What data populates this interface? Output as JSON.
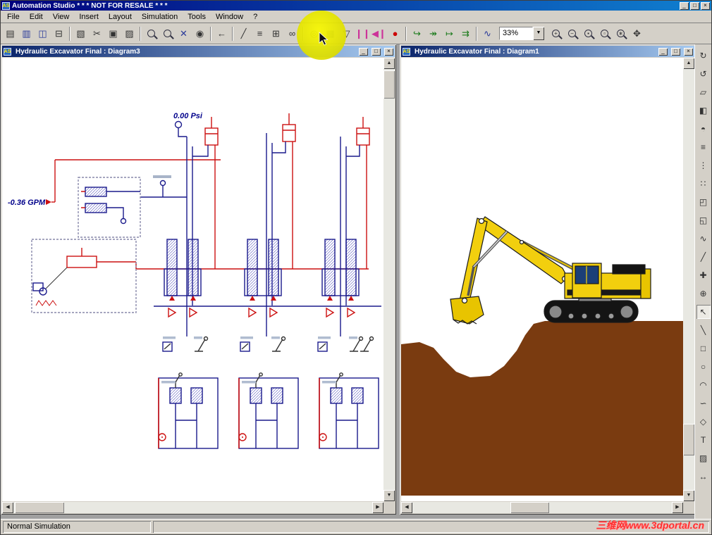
{
  "chrome": {
    "minimize": "_",
    "maximize": "□",
    "close": "×",
    "dropdown": "▼"
  },
  "scroll": {
    "up": "▲",
    "down": "▼",
    "left": "◀",
    "right": "▶"
  },
  "titlebar": {
    "app_icon": "AS",
    "title": "Automation Studio  * * *  NOT FOR RESALE  * * *"
  },
  "menubar": {
    "items": [
      "File",
      "Edit",
      "View",
      "Insert",
      "Layout",
      "Simulation",
      "Tools",
      "Window",
      "?"
    ]
  },
  "toolbar": {
    "zoom_value": "33%",
    "buttons": [
      {
        "name": "new-button",
        "glyph": "▤"
      },
      {
        "name": "open-button",
        "glyph": "▥"
      },
      {
        "name": "save-button",
        "glyph": "◫"
      },
      {
        "name": "print-button",
        "glyph": "⊟"
      },
      {
        "name": "preview-button",
        "glyph": "▧"
      },
      {
        "name": "cut-button",
        "glyph": "✂"
      },
      {
        "name": "copy-button",
        "glyph": "▣"
      },
      {
        "name": "paste-button",
        "glyph": "▨"
      },
      {
        "name": "find-button",
        "glyph": ""
      },
      {
        "name": "zoom-selection-button",
        "glyph": ""
      },
      {
        "name": "component-search-button",
        "glyph": "✕"
      },
      {
        "name": "snapshot-button",
        "glyph": "◉"
      },
      {
        "name": "undo-button",
        "glyph": "←"
      },
      {
        "name": "line-tool-button",
        "glyph": "╱"
      },
      {
        "name": "polyline-tool-button",
        "glyph": "≡"
      },
      {
        "name": "grid-button",
        "glyph": "⊞"
      },
      {
        "name": "link-button",
        "glyph": "∞"
      },
      {
        "name": "probe-button",
        "glyph": "◎"
      },
      {
        "name": "measure-button",
        "glyph": "▦"
      },
      {
        "name": "trigger-button",
        "glyph": "▽"
      },
      {
        "name": "pause-button",
        "glyph": "❙❙"
      },
      {
        "name": "play-pause-button",
        "glyph": "◀❙"
      },
      {
        "name": "stop-button",
        "glyph": "●"
      },
      {
        "name": "step-into-button",
        "glyph": "↪"
      },
      {
        "name": "step-over-button",
        "glyph": "↠"
      },
      {
        "name": "step-out-button",
        "glyph": "↦"
      },
      {
        "name": "run-to-button",
        "glyph": "⇉"
      },
      {
        "name": "plot-button",
        "glyph": "∿"
      },
      {
        "name": "zoom-in-button",
        "glyph": "+"
      },
      {
        "name": "zoom-out-button",
        "glyph": "−"
      },
      {
        "name": "zoom-window-button",
        "glyph": "▪"
      },
      {
        "name": "zoom-page-button",
        "glyph": "▫"
      },
      {
        "name": "zoom-all-button",
        "glyph": "∗"
      },
      {
        "name": "pan-button",
        "glyph": "✥"
      }
    ]
  },
  "palette": {
    "buttons": [
      {
        "name": "rotate-cw-button",
        "glyph": "↻"
      },
      {
        "name": "rotate-ccw-button",
        "glyph": "↺"
      },
      {
        "name": "flip-diagonal-button",
        "glyph": "▱"
      },
      {
        "name": "flip-horizontal-button",
        "glyph": "◧"
      },
      {
        "name": "flip-vertical-button",
        "glyph": "◓"
      },
      {
        "name": "align-button",
        "glyph": "≡"
      },
      {
        "name": "distribute-button",
        "glyph": "⋮"
      },
      {
        "name": "snap-grid-button",
        "glyph": "∷"
      },
      {
        "name": "bring-to-front-button",
        "glyph": "◰"
      },
      {
        "name": "send-to-back-button",
        "glyph": "◱"
      },
      {
        "name": "connector-tool-button",
        "glyph": "∿"
      },
      {
        "name": "draw-link-button",
        "glyph": "╱"
      },
      {
        "name": "insert-point-button",
        "glyph": "✚"
      },
      {
        "name": "probe-tool-button",
        "glyph": "⊕"
      },
      {
        "name": "pointer-tool-button",
        "glyph": "↖"
      },
      {
        "name": "line-tool-button",
        "glyph": "╲"
      },
      {
        "name": "rectangle-tool-button",
        "glyph": "□"
      },
      {
        "name": "ellipse-tool-button",
        "glyph": "○"
      },
      {
        "name": "arc-tool-button",
        "glyph": "◠"
      },
      {
        "name": "curve-tool-button",
        "glyph": "∽"
      },
      {
        "name": "polygon-tool-button",
        "glyph": "◇"
      },
      {
        "name": "text-tool-button",
        "glyph": "T"
      },
      {
        "name": "image-tool-button",
        "glyph": "▨"
      },
      {
        "name": "fit-view-button",
        "glyph": "↔"
      }
    ]
  },
  "windows": {
    "diagram3": {
      "icon": "AS",
      "title": "Hydraulic Excavator Final : Diagram3",
      "labels": {
        "pressure": "0.00 Psi",
        "flow": "-0.36 GPM"
      }
    },
    "diagram1": {
      "icon": "AS",
      "title": "Hydraulic Excavator Final : Diagram1"
    }
  },
  "statusbar": {
    "mode": "Normal Simulation",
    "watermark": "三维网www.3dportal.cn"
  },
  "colors": {
    "title_blue": "#0a246a",
    "schematic_red": "#cc1111",
    "schematic_blue": "#1a1a8c",
    "highlight_yellow": "#e9e900",
    "ground_brown": "#7a3b10",
    "excavator_yellow": "#f2cf0e",
    "stop_red": "#cc0000"
  }
}
